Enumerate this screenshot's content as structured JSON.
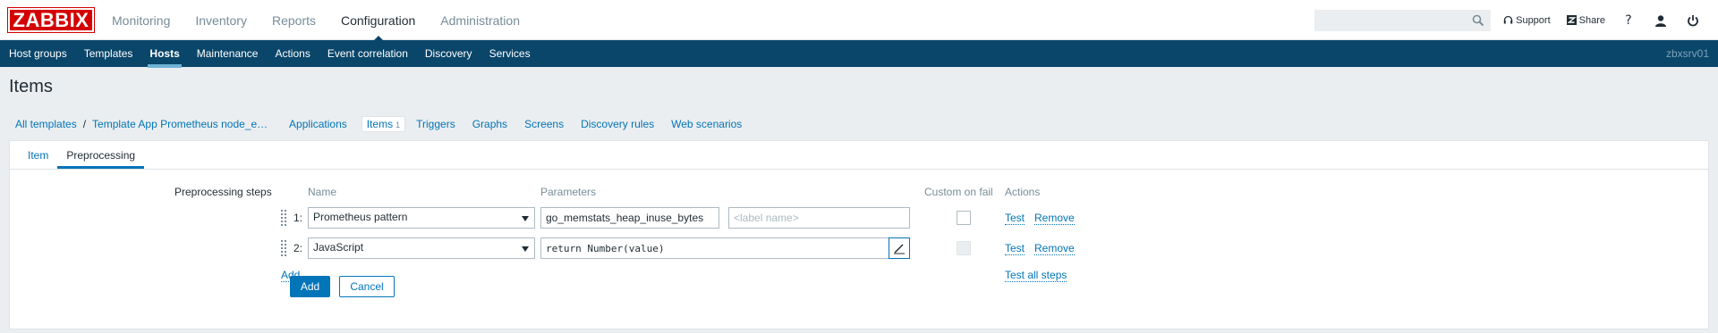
{
  "logo": "ZABBIX",
  "main_menu": [
    "Monitoring",
    "Inventory",
    "Reports",
    "Configuration",
    "Administration"
  ],
  "main_menu_active": "Configuration",
  "top_right": {
    "search_placeholder": "",
    "support": "Support",
    "share": "Share",
    "help": "?"
  },
  "sub_menu": [
    "Host groups",
    "Templates",
    "Hosts",
    "Maintenance",
    "Actions",
    "Event correlation",
    "Discovery",
    "Services"
  ],
  "sub_menu_active": "Hosts",
  "server_name": "zbxsrv01",
  "page_title": "Items",
  "breadcrumbs": {
    "all_templates": "All templates",
    "separator": "/",
    "template": "Template App Prometheus node_exporter",
    "links": [
      "Applications",
      "Items",
      "Triggers",
      "Graphs",
      "Screens",
      "Discovery rules",
      "Web scenarios"
    ],
    "items_count": "1"
  },
  "form_tabs": [
    "Item",
    "Preprocessing"
  ],
  "form_tabs_active": "Preprocessing",
  "preprocessing": {
    "label": "Preprocessing steps",
    "headers": {
      "name": "Name",
      "parameters": "Parameters",
      "custom_on_fail": "Custom on fail",
      "actions": "Actions"
    },
    "steps": [
      {
        "num": "1:",
        "type": "Prometheus pattern",
        "param1": "go_memstats_heap_inuse_bytes",
        "param2_placeholder": "<label name>",
        "custom_on_fail": false,
        "custom_disabled": false,
        "test": "Test",
        "remove": "Remove"
      },
      {
        "num": "2:",
        "type": "JavaScript",
        "param1": "return Number(value)",
        "custom_on_fail": false,
        "custom_disabled": true,
        "test": "Test",
        "remove": "Remove"
      }
    ],
    "add_link": "Add",
    "test_all": "Test all steps"
  },
  "buttons": {
    "add": "Add",
    "cancel": "Cancel"
  },
  "colors": {
    "brand": "#d40000",
    "nav": "#0a466a",
    "link": "#0275b8",
    "page_bg": "#ebeef0"
  }
}
